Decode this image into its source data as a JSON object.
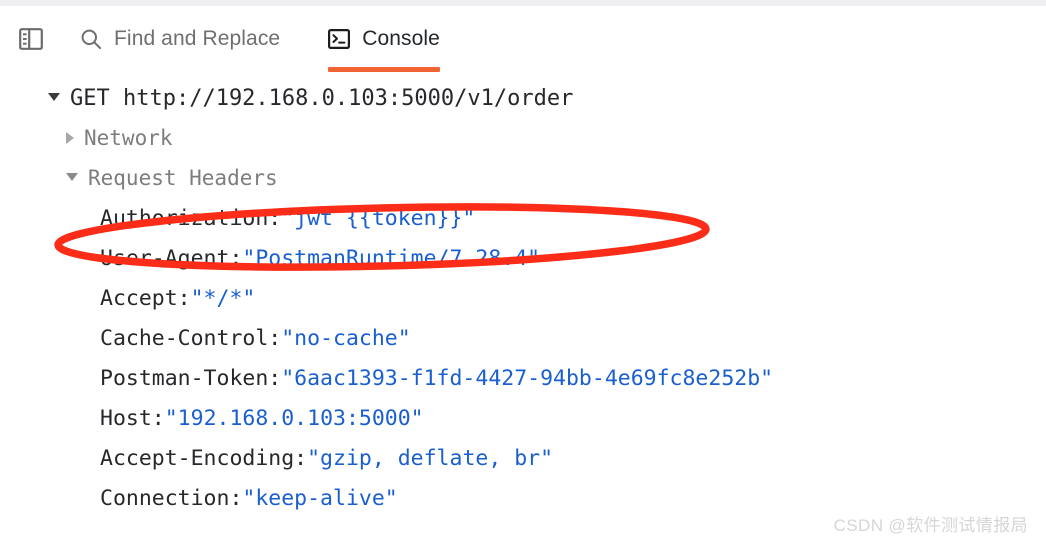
{
  "toolbar": {
    "panel_icon": "sidebar-panel-icon",
    "find": {
      "icon": "search-icon",
      "label": "Find and Replace"
    },
    "console": {
      "icon": "terminal-icon",
      "label": "Console",
      "active": true,
      "accent": "#f26334"
    }
  },
  "console": {
    "request": {
      "expander": "caret-down",
      "text": "GET http://192.168.0.103:5000/v1/order"
    },
    "sections": [
      {
        "expander": "caret-right",
        "label": "Network",
        "expanded": false
      },
      {
        "expander": "caret-down",
        "label": "Request Headers",
        "expanded": true
      }
    ],
    "headers": [
      {
        "key": "Authorization:",
        "value": "\"jwt {{token}}\""
      },
      {
        "key": "User-Agent:",
        "value": "\"PostmanRuntime/7.28.4\""
      },
      {
        "key": "Accept:",
        "value": "\"*/*\""
      },
      {
        "key": "Cache-Control:",
        "value": "\"no-cache\""
      },
      {
        "key": "Postman-Token:",
        "value": "\"6aac1393-f1fd-4427-94bb-4e69fc8e252b\""
      },
      {
        "key": "Host:",
        "value": "\"192.168.0.103:5000\""
      },
      {
        "key": "Accept-Encoding:",
        "value": "\"gzip, deflate, br\""
      },
      {
        "key": "Connection:",
        "value": "\"keep-alive\""
      }
    ]
  },
  "annotation": {
    "shape": "ellipse",
    "color": "#fb2c18",
    "target": "Authorization header row"
  },
  "watermark": {
    "text": "CSDN @软件测试情报局"
  },
  "colors": {
    "accent_orange": "#f26334",
    "value_blue": "#1a5fd0",
    "key_dark": "#26282b",
    "muted_gray": "#7d7d7d",
    "annotation_red": "#fb2c18"
  }
}
